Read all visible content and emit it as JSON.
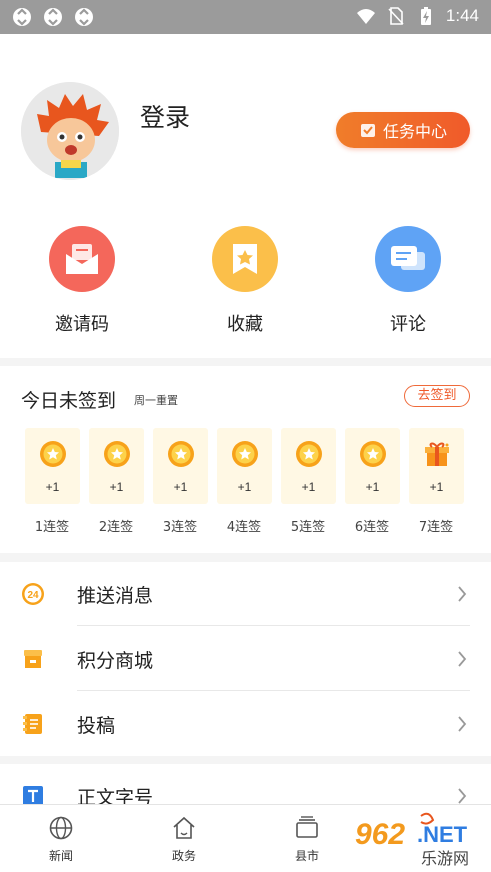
{
  "status_bar": {
    "time": "1:44"
  },
  "profile": {
    "login_label": "登录",
    "task_center_label": "任务中心",
    "quick_actions": [
      {
        "label": "邀请码",
        "color": "#f4675b"
      },
      {
        "label": "收藏",
        "color": "#fbbf4a"
      },
      {
        "label": "评论",
        "color": "#5fa3f5"
      }
    ]
  },
  "signin": {
    "title": "今日未签到",
    "subtitle": "周一重置",
    "button_label": "去签到",
    "days": [
      {
        "reward": "+1",
        "label": "1连签"
      },
      {
        "reward": "+1",
        "label": "2连签"
      },
      {
        "reward": "+1",
        "label": "3连签"
      },
      {
        "reward": "+1",
        "label": "4连签"
      },
      {
        "reward": "+1",
        "label": "5连签"
      },
      {
        "reward": "+1",
        "label": "6连签"
      },
      {
        "reward": "+1",
        "label": "7连签"
      }
    ]
  },
  "menu": {
    "items": [
      {
        "label": "推送消息",
        "icon": "push-24-icon"
      },
      {
        "label": "积分商城",
        "icon": "store-icon"
      },
      {
        "label": "投稿",
        "icon": "notebook-icon"
      },
      {
        "label": "正文字号",
        "icon": "text-size-icon"
      }
    ]
  },
  "tabbar": {
    "tabs": [
      {
        "label": "新闻",
        "icon": "globe-icon"
      },
      {
        "label": "政务",
        "icon": "home-icon"
      },
      {
        "label": "县市",
        "icon": "layers-icon"
      }
    ]
  },
  "watermark": {
    "text": "962.NET",
    "sub": "乐游网"
  },
  "colors": {
    "accent": "#f05a2a",
    "coin": "#f7a21a",
    "status_bar": "#9b9b9b"
  }
}
